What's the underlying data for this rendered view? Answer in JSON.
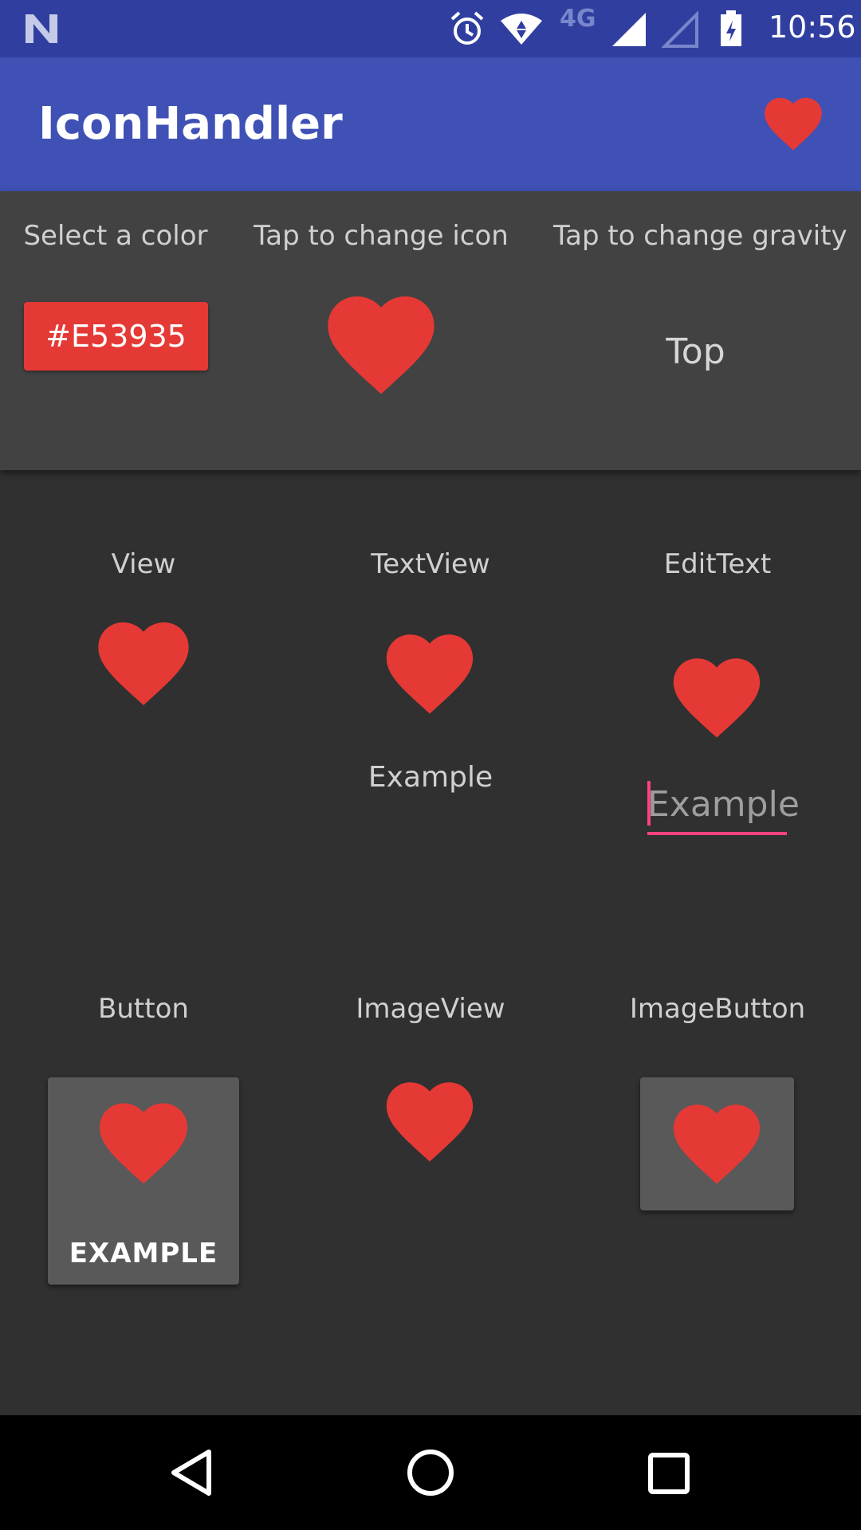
{
  "status_bar": {
    "network_type": "4G",
    "time": "10:56",
    "icons": [
      "notification-n-icon",
      "alarm-icon",
      "wifi-icon",
      "signal-icon",
      "signal-empty-icon",
      "battery-charging-icon"
    ]
  },
  "app_bar": {
    "title": "IconHandler",
    "action_icon": "heart-icon"
  },
  "controls": {
    "color_label": "Select a color",
    "color_value": "#E53935",
    "icon_label": "Tap to change icon",
    "gravity_label": "Tap to change gravity",
    "gravity_value": "Top"
  },
  "examples": {
    "view_label": "View",
    "textview_label": "TextView",
    "textview_text": "Example",
    "edittext_label": "EditText",
    "edittext_value": "Example",
    "button_label": "Button",
    "button_text": "EXAMPLE",
    "imageview_label": "ImageView",
    "imagebutton_label": "ImageButton"
  },
  "nav_bar": {
    "icons": [
      "back-icon",
      "home-icon",
      "recents-icon"
    ]
  },
  "colors": {
    "accent": "#e53935",
    "primary": "#3f51b5",
    "primary_dark": "#303f9f",
    "edit_accent": "#ff4081"
  }
}
